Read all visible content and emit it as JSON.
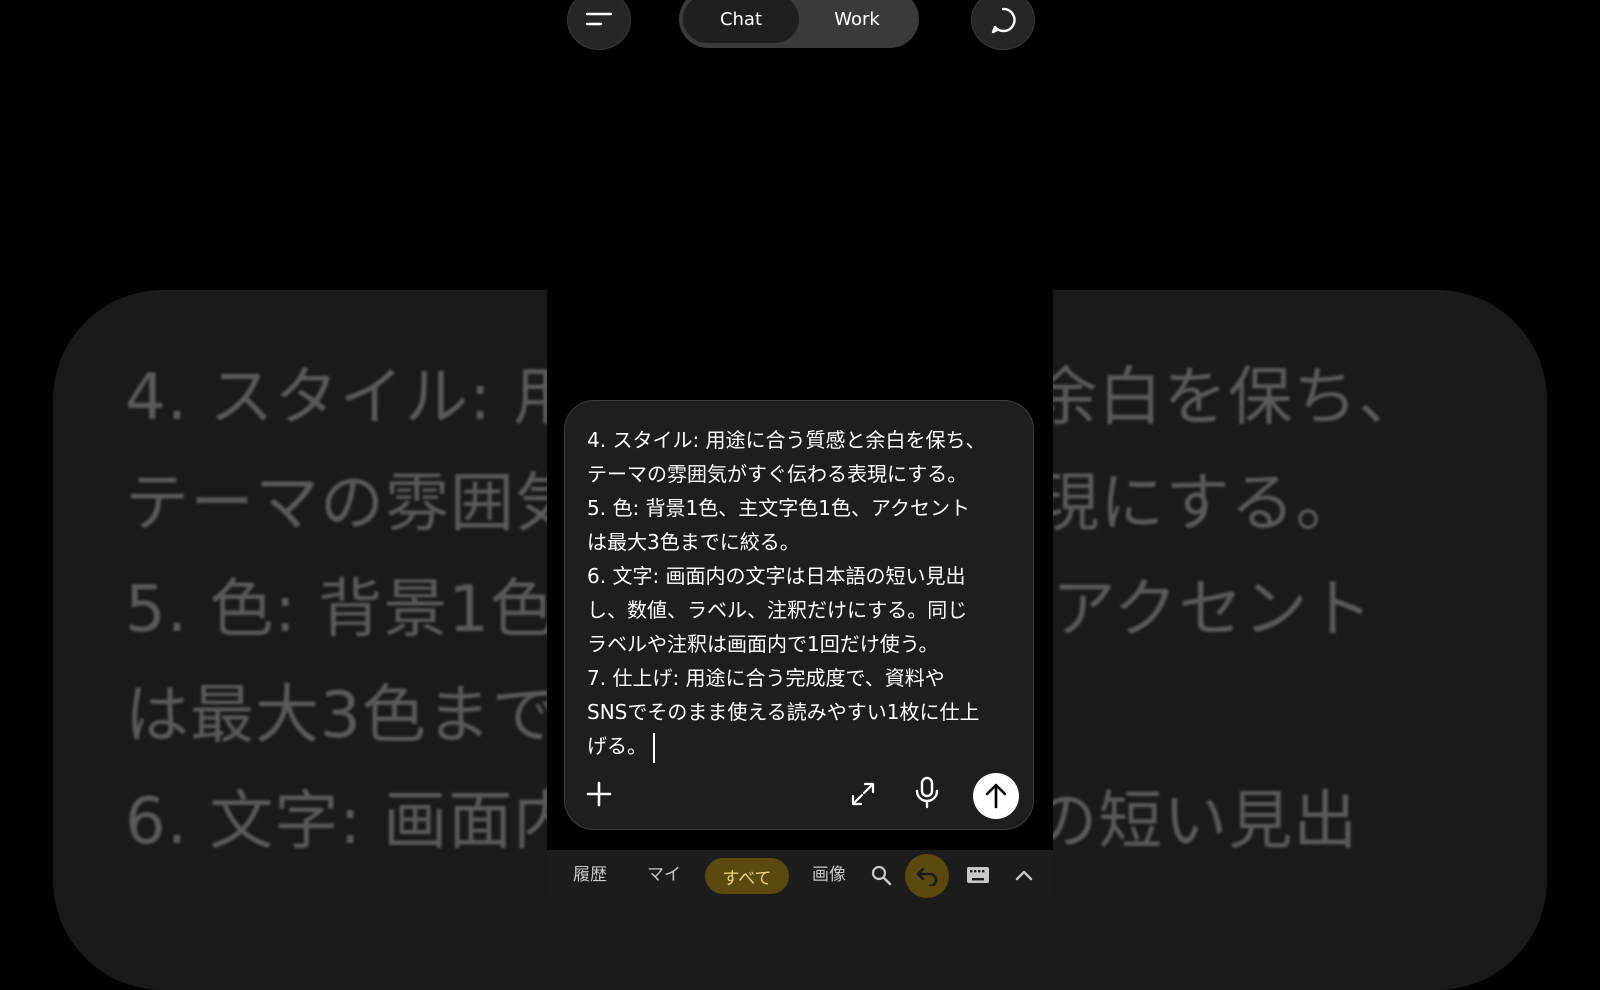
{
  "top_bar": {
    "segments": [
      {
        "label": "Chat",
        "active": true
      },
      {
        "label": "Work",
        "active": false
      }
    ]
  },
  "composer": {
    "text": "4. スタイル: 用途に合う質感と余白を保ち、\nテーマの雰囲気がすぐ伝わる表現にする。\n5. 色: 背景1色、主文字色1色、アクセント\nは最大3色までに絞る。\n6. 文字: 画面内の文字は日本語の短い見出\nし、数値、ラベル、注釈だけにする。同じ\nラベルや注釈は画面内で1回だけ使う。\n7. 仕上げ: 用途に合う完成度で、資料や\nSNSでそのまま使える読みやすい1枚に仕上\nげる。"
  },
  "background_echo": {
    "text": "4. スタイル: 用途に合う質感と余白を保ち、\nテーマの雰囲気がすぐ伝わる表現にする。\n5. 色: 背景1色、主文字色1色、アクセント\nは最大3色までに絞る。\n6. 文字: 画面内の文字は日本語の短い見出"
  },
  "keyboard_bar": {
    "items": [
      "履歴",
      "マイ",
      "画像"
    ],
    "active": "すべて"
  },
  "colors": {
    "accent_pill": "#5a4a10",
    "accent_text": "#f2d478",
    "background": "#000000",
    "composer_bg": "#1e1e1e"
  },
  "icons": {
    "menu": "menu-icon",
    "chat": "chat-bubble-icon",
    "plus": "plus-icon",
    "expand": "expand-icon",
    "mic": "microphone-icon",
    "send": "arrow-up-icon",
    "search": "search-icon",
    "undo": "undo-icon",
    "keyboard": "keyboard-icon",
    "chevron": "chevron-up-icon"
  }
}
